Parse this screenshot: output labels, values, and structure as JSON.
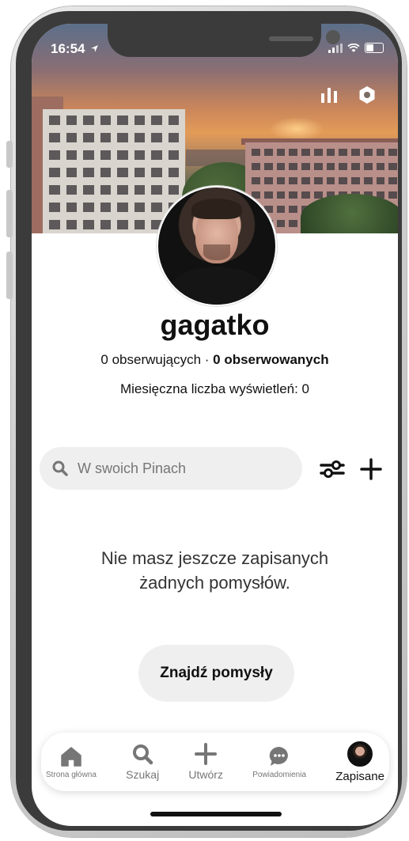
{
  "status_bar": {
    "time": "16:54"
  },
  "profile": {
    "username": "gagatko",
    "followers_text": "0 obserwujących · ",
    "following_text": "0 obserwowanych",
    "monthly_views": "Miesięczna liczba wyświetleń: 0"
  },
  "search": {
    "placeholder": "W swoich Pinach"
  },
  "empty_state": {
    "message": "Nie masz jeszcze zapisanych żadnych pomysłów.",
    "button_label": "Znajdź pomysły"
  },
  "nav": {
    "items": [
      {
        "label": "Strona główna",
        "icon": "home-icon"
      },
      {
        "label": "Szukaj",
        "icon": "search-icon"
      },
      {
        "label": "Utwórz",
        "icon": "plus-icon"
      },
      {
        "label": "Powiadomienia",
        "icon": "chat-bubble-icon"
      },
      {
        "label": "Zapisane",
        "icon": "avatar-icon",
        "active": true
      }
    ]
  },
  "colors": {
    "accent_bg": "#efefef",
    "text": "#111111",
    "muted": "#767676"
  }
}
